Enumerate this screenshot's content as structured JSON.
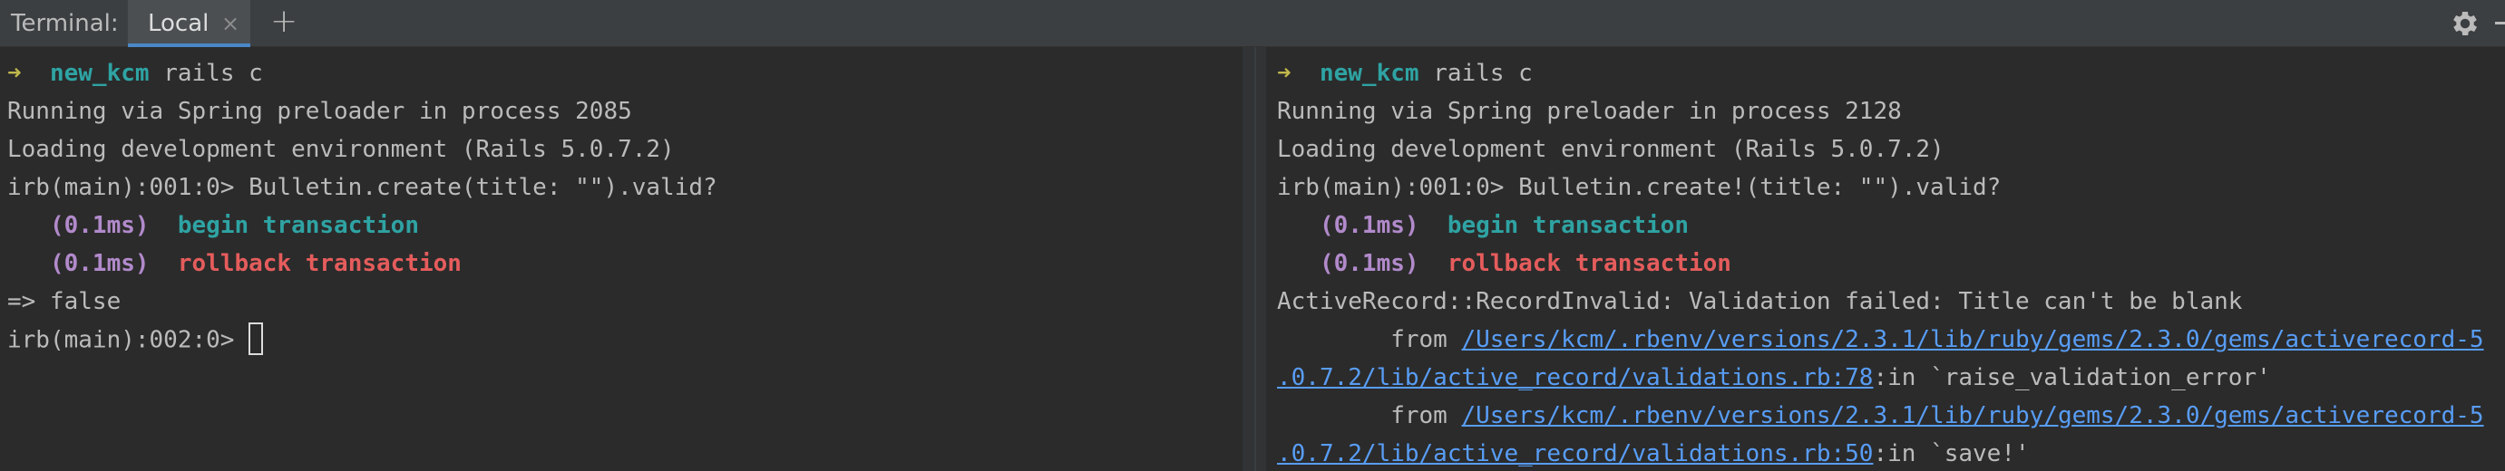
{
  "tabbar": {
    "title": "Terminal:",
    "tabs": [
      {
        "label": "Local",
        "close": "×"
      }
    ],
    "add": "+"
  },
  "left": {
    "lines": [
      {
        "arrow": "➜",
        "dir": "new_kcm",
        "cmd": "rails c"
      },
      {
        "text": "Running via Spring preloader in process 2085"
      },
      {
        "text": "Loading development environment (Rails 5.0.7.2)"
      },
      {
        "text": "irb(main):001:0> Bulletin.create(title: \"\").valid?"
      },
      {
        "ms": "(0.1ms)",
        "sql": "begin transaction"
      },
      {
        "ms": "(0.1ms)",
        "sql": "rollback transaction"
      },
      {
        "text": "=> false"
      },
      {
        "text": "irb(main):002:0> "
      }
    ]
  },
  "right": {
    "lines": [
      {
        "arrow": "➜",
        "dir": "new_kcm",
        "cmd": "rails c"
      },
      {
        "text": "Running via Spring preloader in process 2128"
      },
      {
        "text": "Loading development environment (Rails 5.0.7.2)"
      },
      {
        "text": "irb(main):001:0> Bulletin.create!(title: \"\").valid?"
      },
      {
        "ms": "(0.1ms)",
        "sql": "begin transaction"
      },
      {
        "ms": "(0.1ms)",
        "sql": "rollback transaction"
      },
      {
        "text": "ActiveRecord::RecordInvalid: Validation failed: Title can't be blank"
      },
      {
        "prefix": "        from ",
        "link": "/Users/kcm/.rbenv/versions/2.3.1/lib/ruby/gems/2.3.0/gems/activerecord-5"
      },
      {
        "link": ".0.7.2/lib/active_record/validations.rb:78",
        "suffix": ":in `raise_validation_error'"
      },
      {
        "prefix": "        from ",
        "link": "/Users/kcm/.rbenv/versions/2.3.1/lib/ruby/gems/2.3.0/gems/activerecord-5"
      },
      {
        "link": ".0.7.2/lib/active_record/validations.rb:50",
        "suffix": ":in `save!'"
      }
    ]
  },
  "colors": {
    "background": "#2b2b2b",
    "text": "#bbbbbb",
    "prompt_arrow": "#c0b84b",
    "directory": "#2fa3a3",
    "timing": "#b18acb",
    "begin_transaction": "#2fa3a3",
    "rollback_transaction": "#e55c5c",
    "link": "#589df6",
    "tab_accent": "#4a88c7"
  },
  "icons": {
    "settings": "gear-icon",
    "minimize": "minimize-icon",
    "close_tab": "close-icon",
    "new_tab": "plus-icon"
  }
}
